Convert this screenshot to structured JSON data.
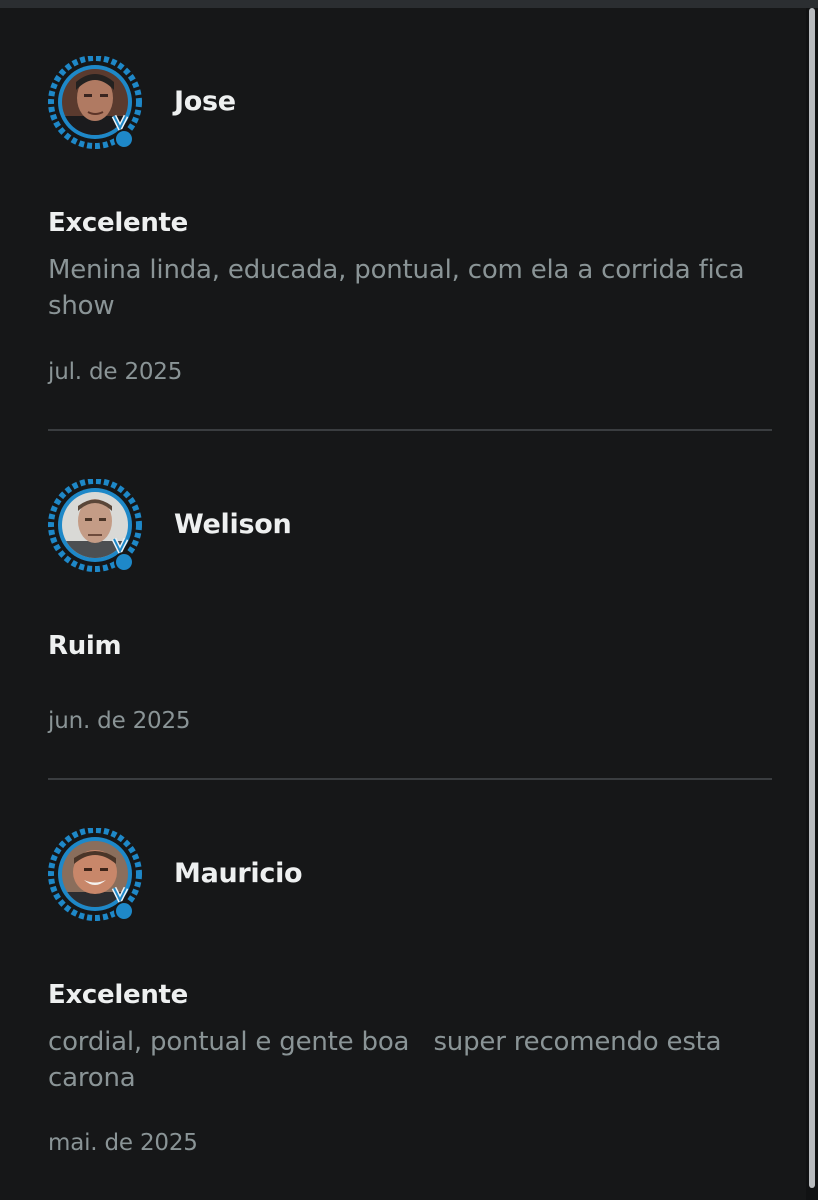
{
  "reviews": [
    {
      "name": "Jose",
      "rating": "Excelente",
      "comment": "Menina linda, educada, pontual, com ela a corrida fica show",
      "date": "jul. de 2025",
      "avatar": "user-photo",
      "badge": "medal-icon"
    },
    {
      "name": "Welison",
      "rating": "Ruim",
      "comment": "",
      "date": "jun. de 2025",
      "avatar": "user-photo",
      "badge": "medal-icon"
    },
    {
      "name": "Mauricio",
      "rating": "Excelente",
      "comment": "cordial, pontual e gente boa   super recomendo esta carona",
      "date": "mai. de 2025",
      "avatar": "user-photo",
      "badge": "medal-icon"
    }
  ],
  "colors": {
    "background": "#161718",
    "accent": "#1e88c8",
    "primary_text": "#eef0f0",
    "secondary_text": "#8a9496",
    "divider": "#3a3d40"
  }
}
